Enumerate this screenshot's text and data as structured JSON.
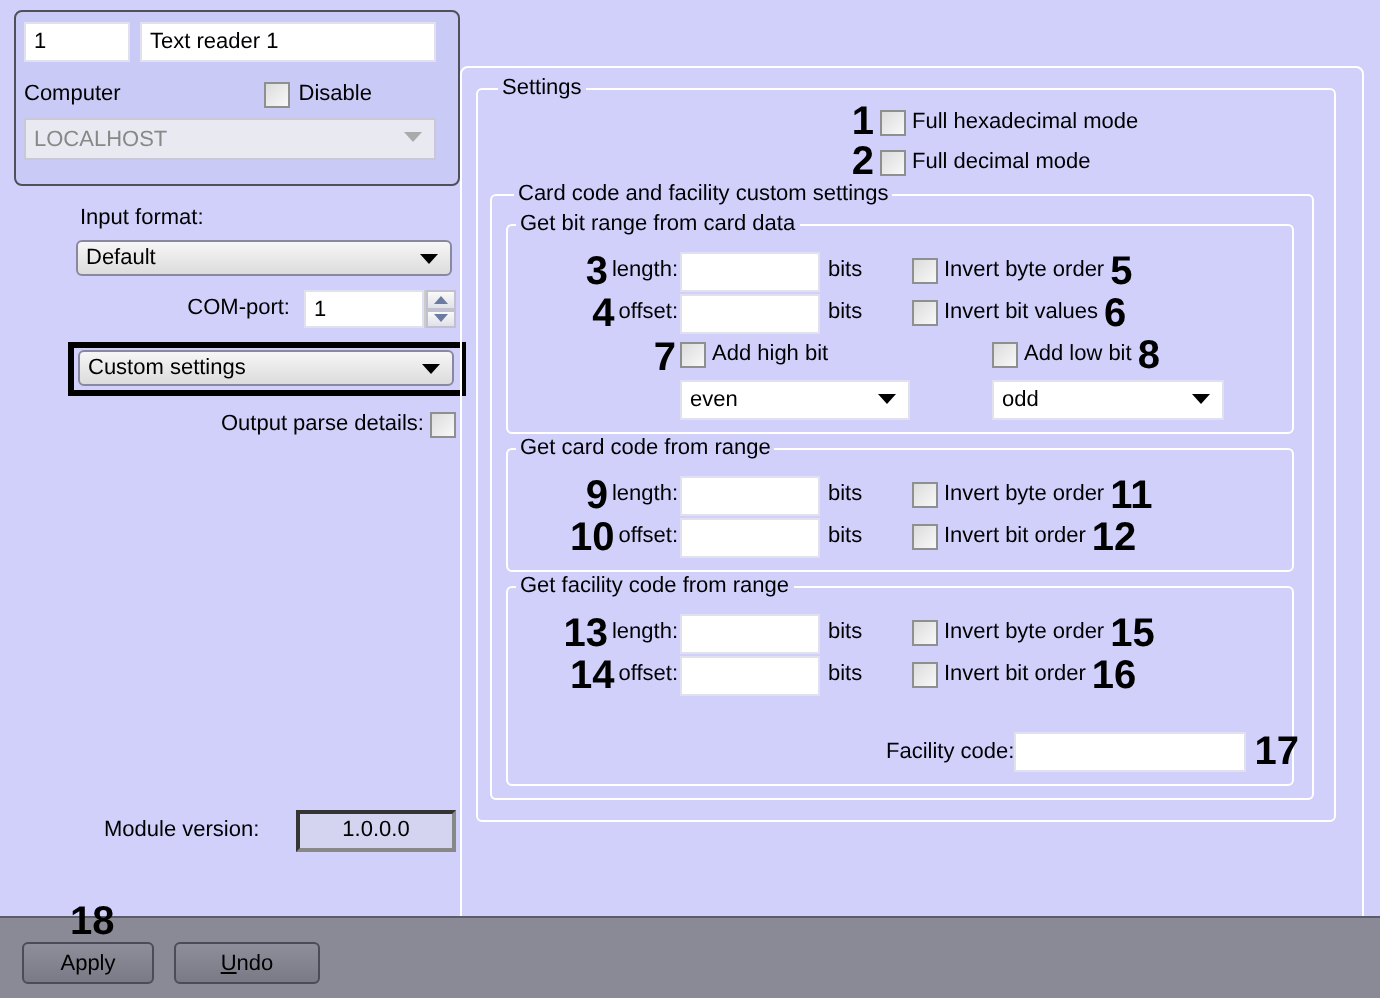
{
  "header": {
    "number": "1",
    "name": "Text reader 1",
    "computer_label": "Computer",
    "disable": {
      "label": "Disable",
      "checked": false
    },
    "computer": "LOCALHOST"
  },
  "input_format": {
    "label": "Input format:",
    "value": "Default"
  },
  "com_port": {
    "label": "COM-port:",
    "value": "1"
  },
  "parse_mode": {
    "value": "Custom settings"
  },
  "output_parse_details": {
    "label": "Output parse details:",
    "checked": false
  },
  "module_version": {
    "label": "Module version:",
    "value": "1.0.0.0"
  },
  "settings": {
    "title": "Settings",
    "modes": [
      {
        "callout": "1",
        "label": "Full hexadecimal mode",
        "checked": false
      },
      {
        "callout": "2",
        "label": "Full decimal mode",
        "checked": false
      }
    ],
    "custom": {
      "title": "Card code and facility custom settings",
      "groups": [
        {
          "title": "Get bit range from card data",
          "rows": [
            {
              "callout": "3",
              "label": "length:",
              "unit": "bits",
              "option": {
                "label": "Invert byte order",
                "callout": "5",
                "checked": false
              }
            },
            {
              "callout": "4",
              "label": "offset:",
              "unit": "bits",
              "option": {
                "label": "Invert bit values",
                "callout": "6",
                "checked": false
              }
            }
          ],
          "bits": [
            {
              "callout": "7",
              "label": "Add high bit",
              "checked": false,
              "value": "even"
            },
            {
              "callout": "8",
              "label": "Add low bit",
              "checked": false,
              "value": "odd"
            }
          ]
        },
        {
          "title": "Get card code from range",
          "rows": [
            {
              "callout": "9",
              "label": "length:",
              "unit": "bits",
              "option": {
                "label": "Invert byte order",
                "callout": "11",
                "checked": false
              }
            },
            {
              "callout": "10",
              "label": "offset:",
              "unit": "bits",
              "option": {
                "label": "Invert bit order",
                "callout": "12",
                "checked": false
              }
            }
          ]
        },
        {
          "title": "Get facility code from range",
          "rows": [
            {
              "callout": "13",
              "label": "length:",
              "unit": "bits",
              "option": {
                "label": "Invert byte order",
                "callout": "15",
                "checked": false
              }
            },
            {
              "callout": "14",
              "label": "offset:",
              "unit": "bits",
              "option": {
                "label": "Invert bit order",
                "callout": "16",
                "checked": false
              }
            }
          ],
          "facility_code": {
            "label": "Facility code:",
            "callout": "17"
          }
        }
      ]
    }
  },
  "buttons": [
    {
      "label": "Apply",
      "callout": "18",
      "underline_first": false
    },
    {
      "label": "Undo",
      "underline_first": true
    }
  ]
}
